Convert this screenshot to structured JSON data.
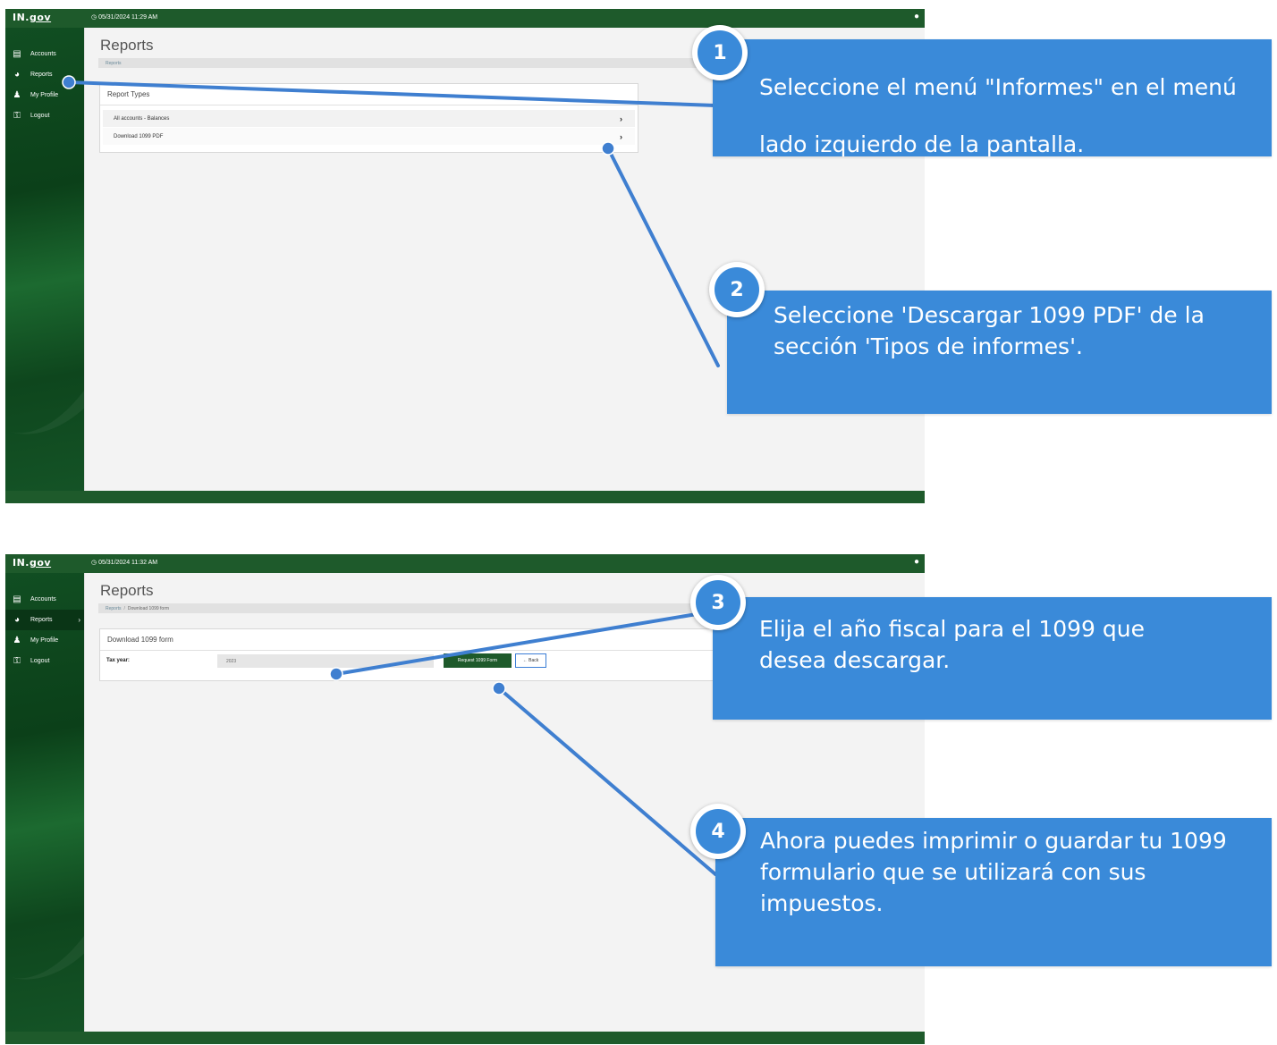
{
  "screen1": {
    "brand": {
      "logo_prefix": "IN.",
      "logo_gov": "gov"
    },
    "topbar": {
      "datetime": "05/31/2024 11:29 AM"
    },
    "nav": [
      {
        "label": "Accounts",
        "icon": "ledger-icon"
      },
      {
        "label": "Reports",
        "icon": "pie-chart-icon"
      },
      {
        "label": "My Profile",
        "icon": "user-profile-icon"
      },
      {
        "label": "Logout",
        "icon": "unlock-icon"
      }
    ],
    "page_title": "Reports",
    "breadcrumb": [
      "Reports"
    ],
    "card": {
      "title": "Report Types",
      "rows": [
        "All accounts - Balances",
        "Download 1099 PDF"
      ]
    }
  },
  "screen2": {
    "brand": {
      "logo_prefix": "IN.",
      "logo_gov": "gov"
    },
    "topbar": {
      "datetime": "05/31/2024 11:32 AM"
    },
    "nav": [
      {
        "label": "Accounts",
        "icon": "ledger-icon"
      },
      {
        "label": "Reports",
        "icon": "pie-chart-icon"
      },
      {
        "label": "My Profile",
        "icon": "user-profile-icon"
      },
      {
        "label": "Logout",
        "icon": "unlock-icon"
      }
    ],
    "page_title": "Reports",
    "breadcrumb": [
      "Reports",
      "Download 1099 form"
    ],
    "breadcrumb_separator": "/",
    "card": {
      "title": "Download 1099 form",
      "tax_year_label": "Tax year:",
      "tax_year_value": "2023",
      "request_button": "Request 1099 Form",
      "back_button": "Back"
    }
  },
  "callouts": [
    {
      "number": "1",
      "text": "Seleccione el menú \"Informes\" en el menú lado izquierdo de la pantalla."
    },
    {
      "number": "2",
      "text": "Seleccione 'Descargar 1099 PDF' de la sección 'Tipos de informes'."
    },
    {
      "number": "3",
      "text": "Elija el año fiscal para el 1099 que desea descargar."
    },
    {
      "number": "4",
      "text": "Ahora puedes imprimir o guardar tu 1099 formulario que se utilizará con sus impuestos."
    }
  ],
  "colors": {
    "brand_green": "#1e5a2b",
    "callout_blue": "#3a8ad9",
    "leader_blue": "#3f7fd0"
  }
}
